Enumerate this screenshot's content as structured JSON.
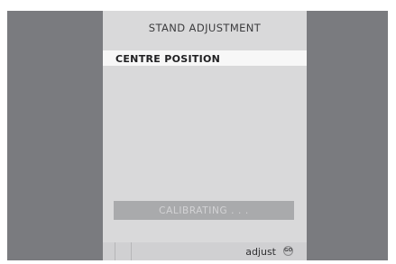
{
  "menu": {
    "title": "STAND ADJUSTMENT",
    "selected_item": "CENTRE POSITION"
  },
  "status": {
    "text": "CALIBRATING . . ."
  },
  "footer": {
    "hint": "adjust",
    "go_icon_label": "GO"
  },
  "colors": {
    "screen_background": "#7a7b7f",
    "panel_background": "#d9d9da",
    "highlight_background": "#f7f7f7",
    "status_bar": "#a9aaac"
  }
}
